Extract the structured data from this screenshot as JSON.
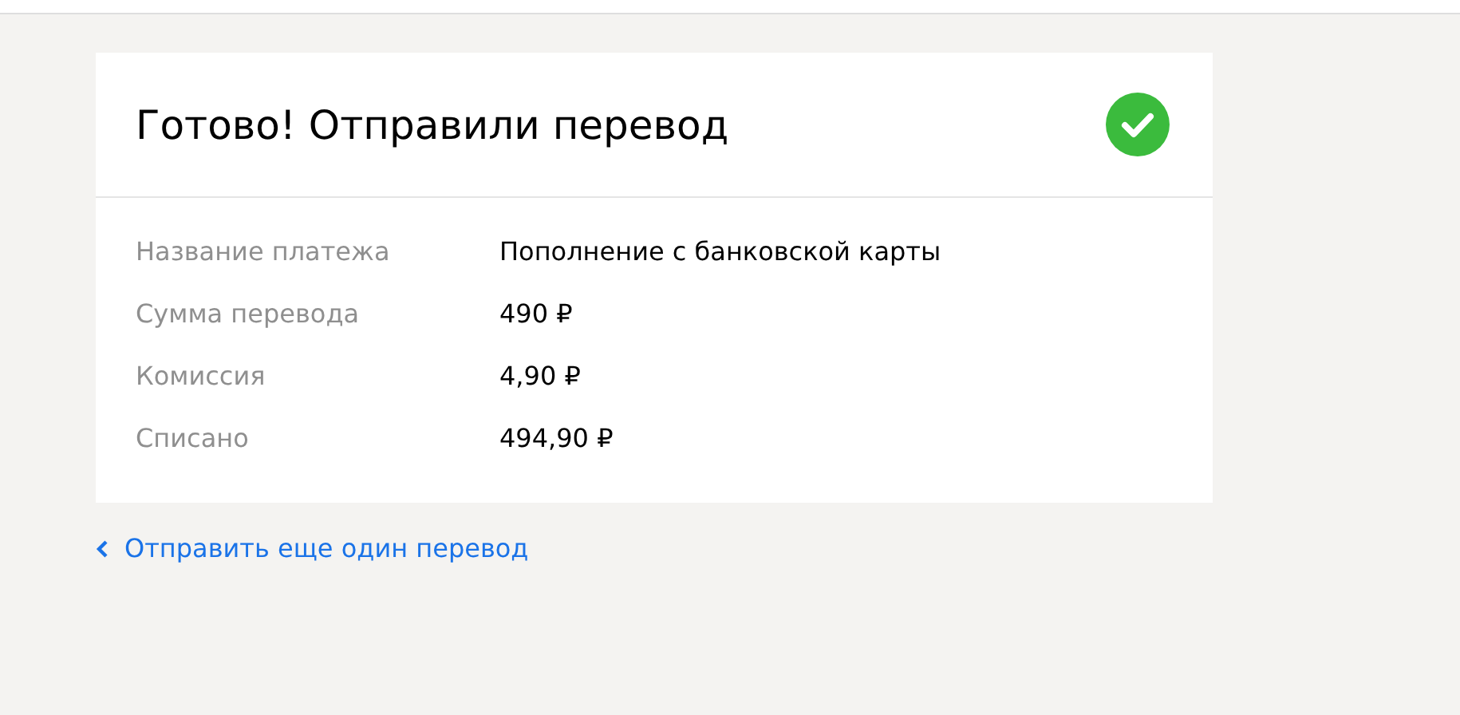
{
  "card": {
    "title": "Готово! Отправили перевод",
    "details": [
      {
        "label": "Название платежа",
        "value": "Пополнение с банковской карты"
      },
      {
        "label": "Сумма перевода",
        "value": "490 ₽"
      },
      {
        "label": "Комиссия",
        "value": "4,90 ₽"
      },
      {
        "label": "Списано",
        "value": "494,90 ₽"
      }
    ]
  },
  "back_link": "Отправить еще один перевод"
}
